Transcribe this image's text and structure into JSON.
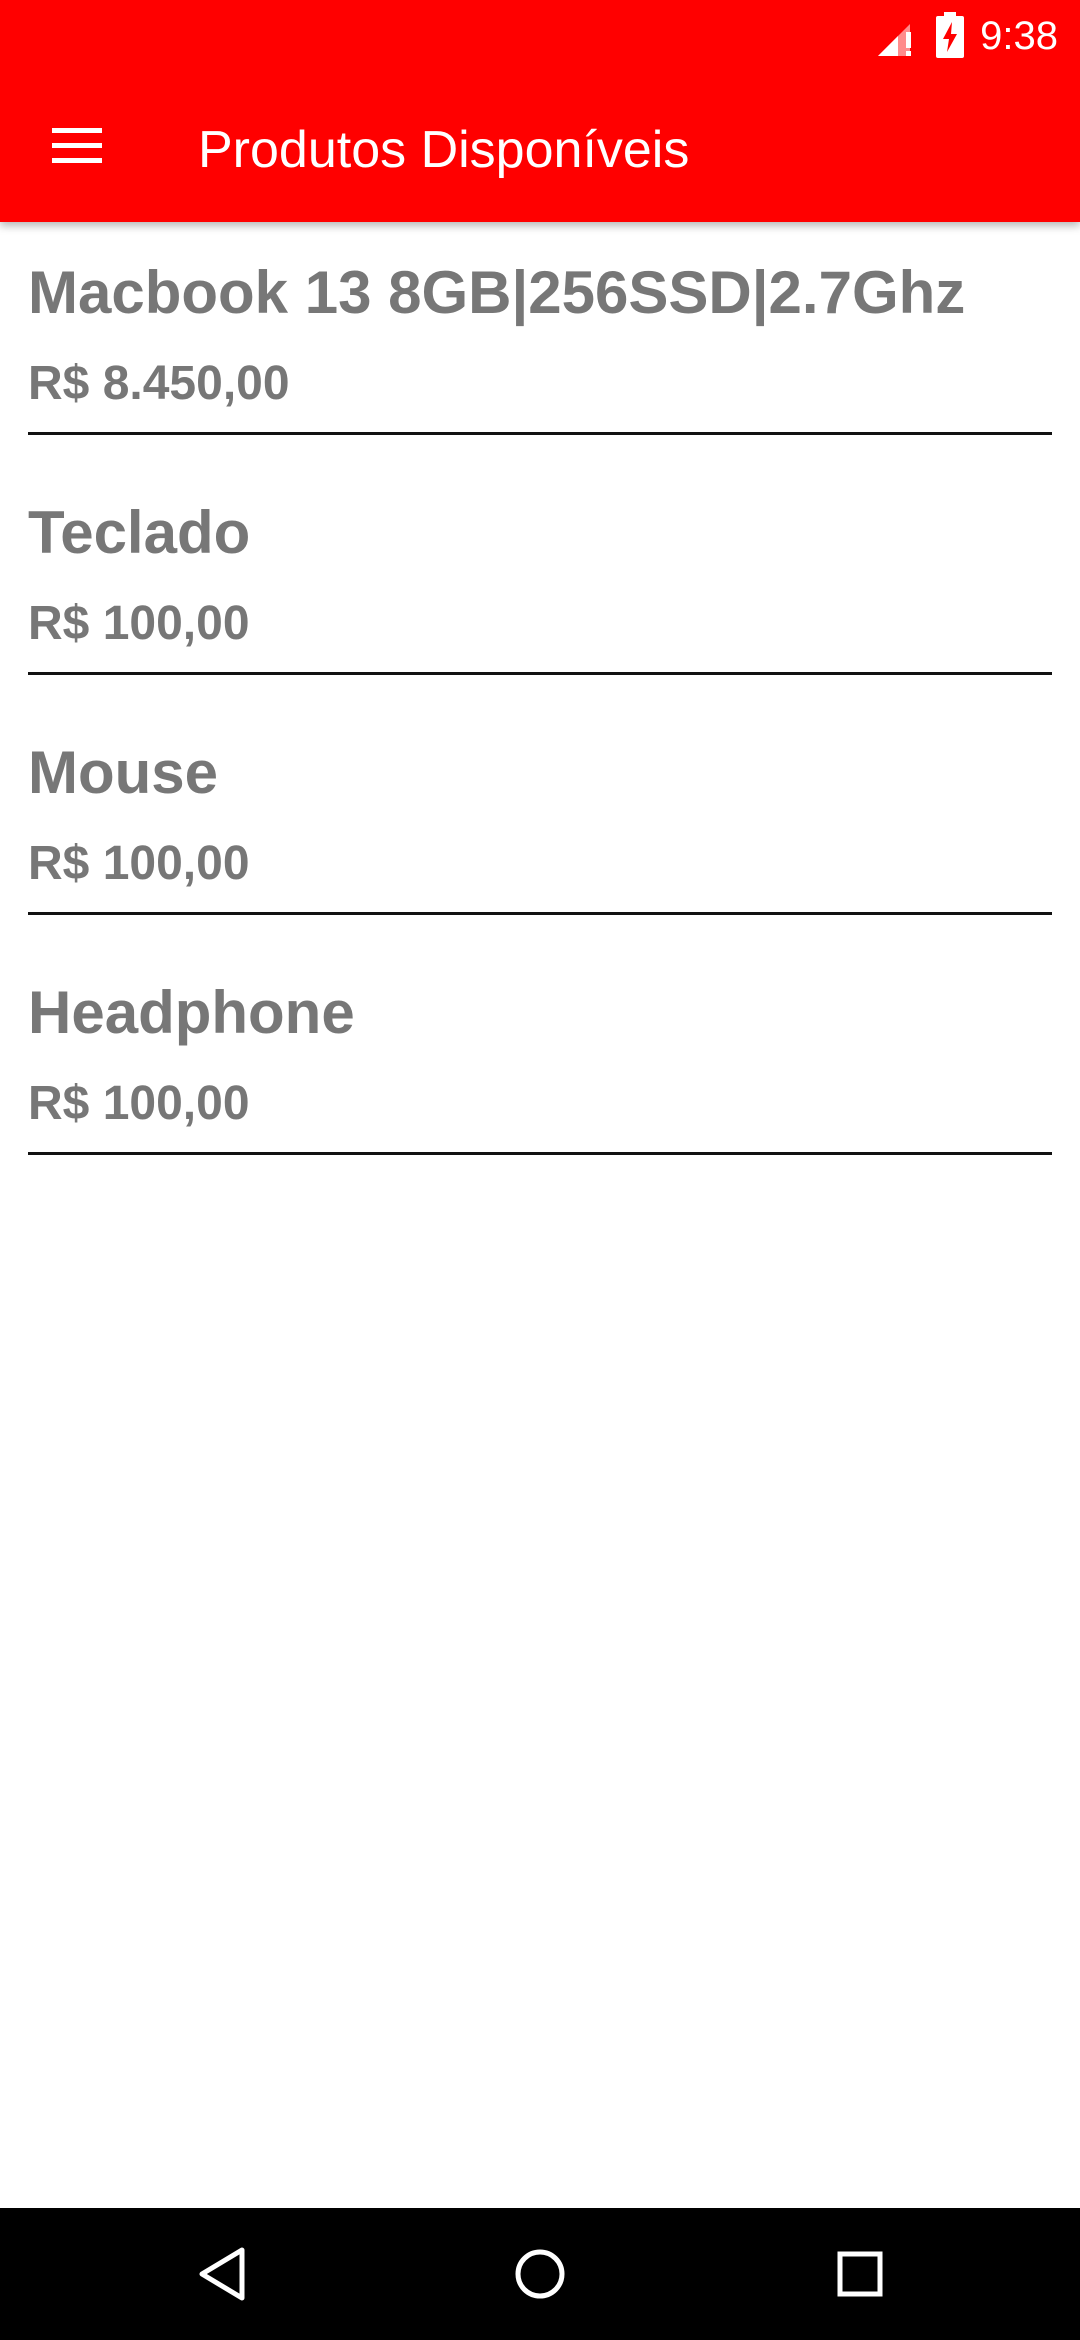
{
  "status_bar": {
    "time": "9:38",
    "signal_icon": "signal-no-data-icon",
    "battery_icon": "battery-charging-icon"
  },
  "app_bar": {
    "title": "Produtos Disponíveis",
    "menu_icon": "hamburger-menu-icon",
    "background_color": "#ff0000"
  },
  "products": [
    {
      "name": "Macbook 13 8GB|256SSD|2.7Ghz",
      "price": "R$ 8.450,00"
    },
    {
      "name": "Teclado",
      "price": "R$ 100,00"
    },
    {
      "name": "Mouse",
      "price": "R$ 100,00"
    },
    {
      "name": "Headphone",
      "price": "R$ 100,00"
    }
  ],
  "nav_bar": {
    "back_icon": "back-triangle-icon",
    "home_icon": "home-circle-icon",
    "recent_icon": "recent-apps-square-icon"
  },
  "colors": {
    "accent": "#ff0000",
    "text_secondary": "#777777",
    "divider": "#111111"
  }
}
